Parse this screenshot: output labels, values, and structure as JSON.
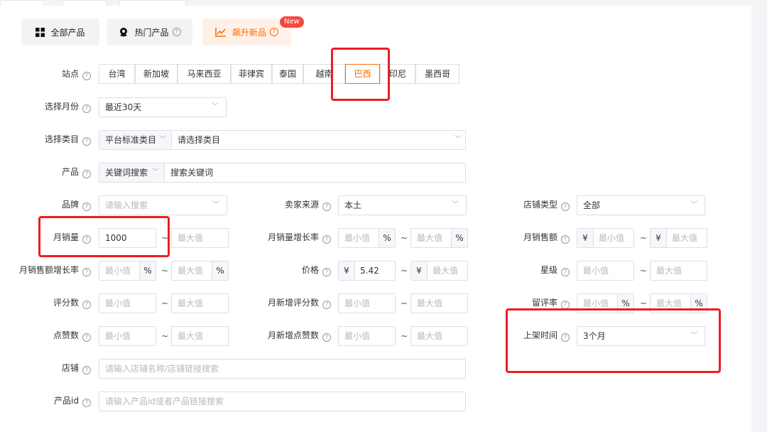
{
  "tabs": {
    "all_products": "全部产品",
    "hot_products": "热门产品",
    "new_products": "飙升新品",
    "new_badge": "New"
  },
  "fields": {
    "site": {
      "label": "站点",
      "options": [
        "台湾",
        "新加坡",
        "马来西亚",
        "菲律宾",
        "泰国",
        "越南",
        "巴西",
        "印尼",
        "墨西哥"
      ],
      "selected": "巴西"
    },
    "month": {
      "label": "选择月份",
      "value": "最近30天"
    },
    "category": {
      "label": "选择类目",
      "type_value": "平台标准类目",
      "placeholder": "请选择类目"
    },
    "product": {
      "label": "产品",
      "mode_value": "关键词搜索",
      "placeholder": "搜索关键词"
    },
    "brand": {
      "label": "品牌",
      "placeholder": "请输入搜索"
    },
    "seller_source": {
      "label": "卖家来源",
      "value": "本土"
    },
    "store_type": {
      "label": "店铺类型",
      "value": "全部"
    },
    "monthly_sales": {
      "label": "月销量",
      "min": "1000",
      "max_placeholder": "最大值"
    },
    "monthly_sales_growth": {
      "label": "月销量增长率",
      "min_placeholder": "最小值",
      "max_placeholder": "最大值",
      "unit": "%"
    },
    "monthly_revenue": {
      "label": "月销售额",
      "min_placeholder": "最小值",
      "max_placeholder": "最大值",
      "currency": "¥"
    },
    "monthly_revenue_growth": {
      "label": "月销售额增长率",
      "min_placeholder": "最小值",
      "max_placeholder": "最大值",
      "unit": "%"
    },
    "price": {
      "label": "价格",
      "min": "5.42",
      "max_placeholder": "最大值",
      "currency": "¥"
    },
    "star_rating": {
      "label": "星级",
      "min_placeholder": "最小值",
      "max_placeholder": "最大值"
    },
    "review_count": {
      "label": "评分数",
      "min_placeholder": "最小值",
      "max_placeholder": "最大值"
    },
    "monthly_new_reviews": {
      "label": "月新增评分数",
      "min_placeholder": "最小值",
      "max_placeholder": "最大值"
    },
    "review_rate": {
      "label": "留评率",
      "min_placeholder": "最小值",
      "max_placeholder": "最大值",
      "unit": "%"
    },
    "likes": {
      "label": "点赞数",
      "min_placeholder": "最小值",
      "max_placeholder": "最大值"
    },
    "monthly_new_likes": {
      "label": "月新增点赞数",
      "min_placeholder": "最小值",
      "max_placeholder": "最大值"
    },
    "listing_time": {
      "label": "上架时间",
      "value": "3个月"
    },
    "store": {
      "label": "店铺",
      "placeholder": "请输入店铺名称/店铺链接搜索"
    },
    "product_id": {
      "label": "产品id",
      "placeholder": "请输入产品id或者产品链接搜索"
    }
  },
  "range_separator": "~",
  "help_glyph": "?",
  "colors": {
    "accent": "#ff6a00",
    "annotation": "#ec1c24",
    "badge": "#f5493d"
  }
}
